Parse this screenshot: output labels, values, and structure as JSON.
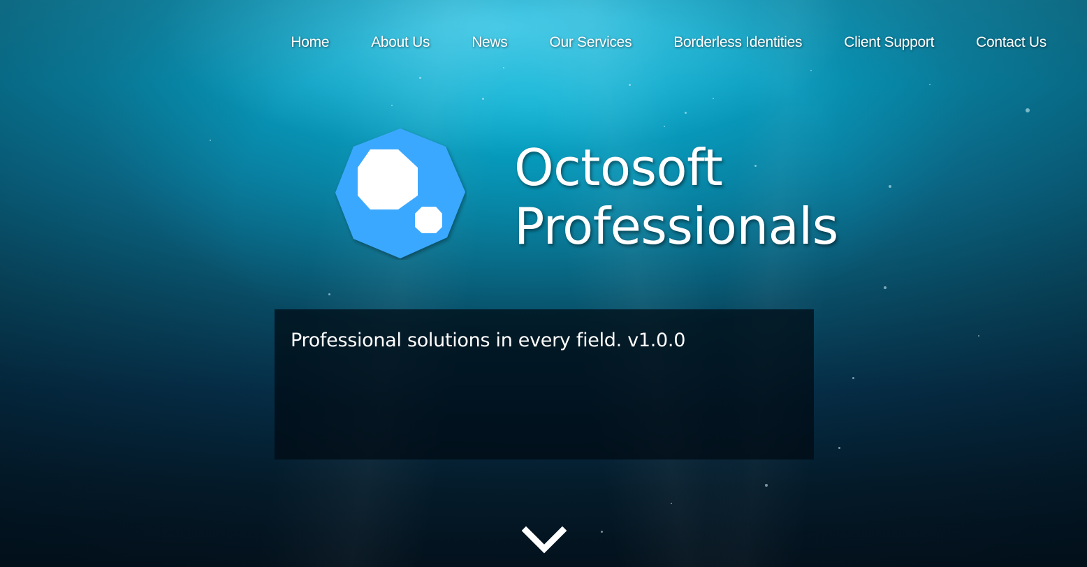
{
  "nav": {
    "items": [
      {
        "label": "Home"
      },
      {
        "label": "About Us"
      },
      {
        "label": "News"
      },
      {
        "label": "Our Services"
      },
      {
        "label": "Borderless Identities"
      },
      {
        "label": "Client Support"
      },
      {
        "label": "Contact Us"
      }
    ]
  },
  "brand": {
    "line1": "Octosoft",
    "line2": "Professionals",
    "logo_icon": "octagon-bubbles-logo",
    "logo_color": "#3aa8ff"
  },
  "hero": {
    "tagline": "Professional solutions in every field. v1.0.0"
  },
  "scroll": {
    "icon": "chevron-down-icon"
  }
}
